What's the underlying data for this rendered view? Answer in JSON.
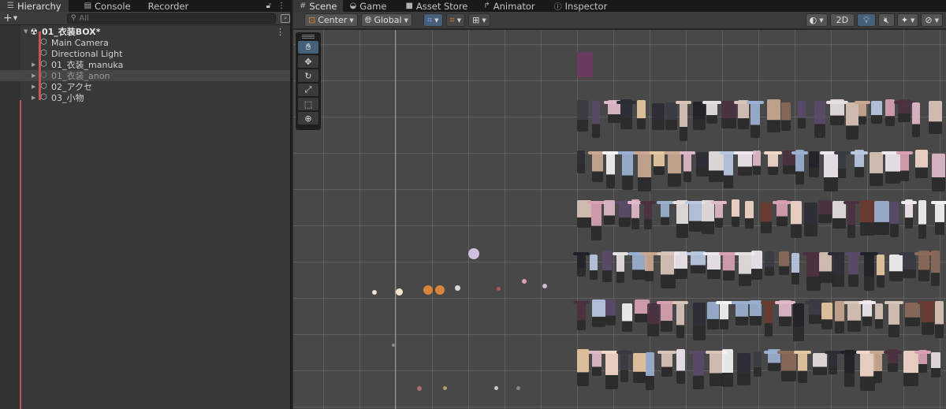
{
  "hierarchy": {
    "tabs": [
      {
        "label": "Hierarchy",
        "icon": "list-icon"
      },
      {
        "label": "Console",
        "icon": "console-icon"
      },
      {
        "label": "Recorder",
        "icon": ""
      }
    ],
    "search_placeholder": "All",
    "scene_name": "01_衣装BOX*",
    "items": [
      {
        "label": "Main Camera",
        "expandable": false
      },
      {
        "label": "Directional Light",
        "expandable": false
      },
      {
        "label": "01_衣装_manuka",
        "expandable": true
      },
      {
        "label": "01_衣装_anon",
        "expandable": true,
        "selected": true
      },
      {
        "label": "02_アクセ",
        "expandable": true
      },
      {
        "label": "03_小物",
        "expandable": true
      }
    ]
  },
  "editor_tabs": [
    {
      "label": "Scene",
      "icon": "grid-icon",
      "active": true
    },
    {
      "label": "Game",
      "icon": "gamepad-icon"
    },
    {
      "label": "Asset Store",
      "icon": "bag-icon"
    },
    {
      "label": "Animator",
      "icon": "animator-icon"
    },
    {
      "label": "Inspector",
      "icon": "info-icon"
    }
  ],
  "scene_toolbar": {
    "pivot_label": "Center",
    "space_label": "Global",
    "mode_2d": "2D"
  },
  "colors": {
    "accent_blue": "#46607c",
    "selection_bar": "#c65656",
    "viewport_bg": "#484848"
  }
}
